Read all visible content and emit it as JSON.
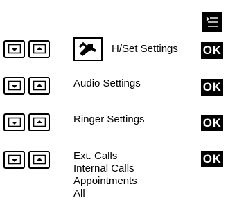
{
  "menu_key": {
    "icon": "menu-icon"
  },
  "rows": [
    {
      "icon": "wrench-icon",
      "label": "H/Set Settings",
      "ok_label": "OK"
    },
    {
      "label": "Audio Settings",
      "ok_label": "OK"
    },
    {
      "label": "Ringer Settings",
      "ok_label": "OK"
    },
    {
      "options": [
        "Ext. Calls",
        "Internal Calls",
        "Appointments",
        "All"
      ],
      "ok_label": "OK"
    }
  ],
  "nav_buttons": {
    "down_icon": "scroll-down-icon",
    "up_icon": "scroll-up-icon"
  },
  "colors": {
    "key_background": "#000000",
    "key_text": "#ffffff",
    "background": "#ffffff"
  }
}
